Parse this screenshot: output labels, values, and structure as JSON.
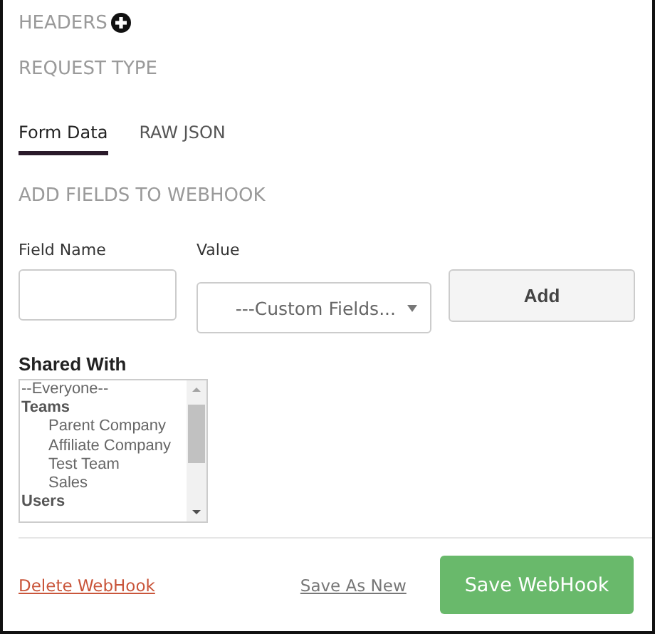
{
  "sections": [
    {
      "label": "HEADERS",
      "addable": true
    },
    {
      "label": "REQUEST TYPE",
      "addable": false
    }
  ],
  "tabs": [
    {
      "label": "Form Data",
      "selected": true
    },
    {
      "label": "RAW JSON",
      "selected": false
    }
  ],
  "fields_heading": "ADD FIELDS TO WEBHOOK",
  "field_name": {
    "label": "Field Name"
  },
  "value": {
    "label": "Value",
    "selected_option": "---Custom Fields..."
  },
  "add_button": "Add",
  "shared_with": {
    "label": "Shared With",
    "options": [
      {
        "label": "--Everyone--",
        "kind": "option"
      },
      {
        "label": "Teams",
        "kind": "group"
      },
      {
        "label": "Parent Company",
        "kind": "option"
      },
      {
        "label": "Affiliate Company",
        "kind": "option"
      },
      {
        "label": "Test Team",
        "kind": "option"
      },
      {
        "label": "Sales",
        "kind": "option"
      },
      {
        "label": "Users",
        "kind": "group"
      }
    ]
  },
  "footer": {
    "delete_link": "Delete WebHook",
    "save_as_new_link": "Save As New",
    "save_button": "Save WebHook"
  }
}
